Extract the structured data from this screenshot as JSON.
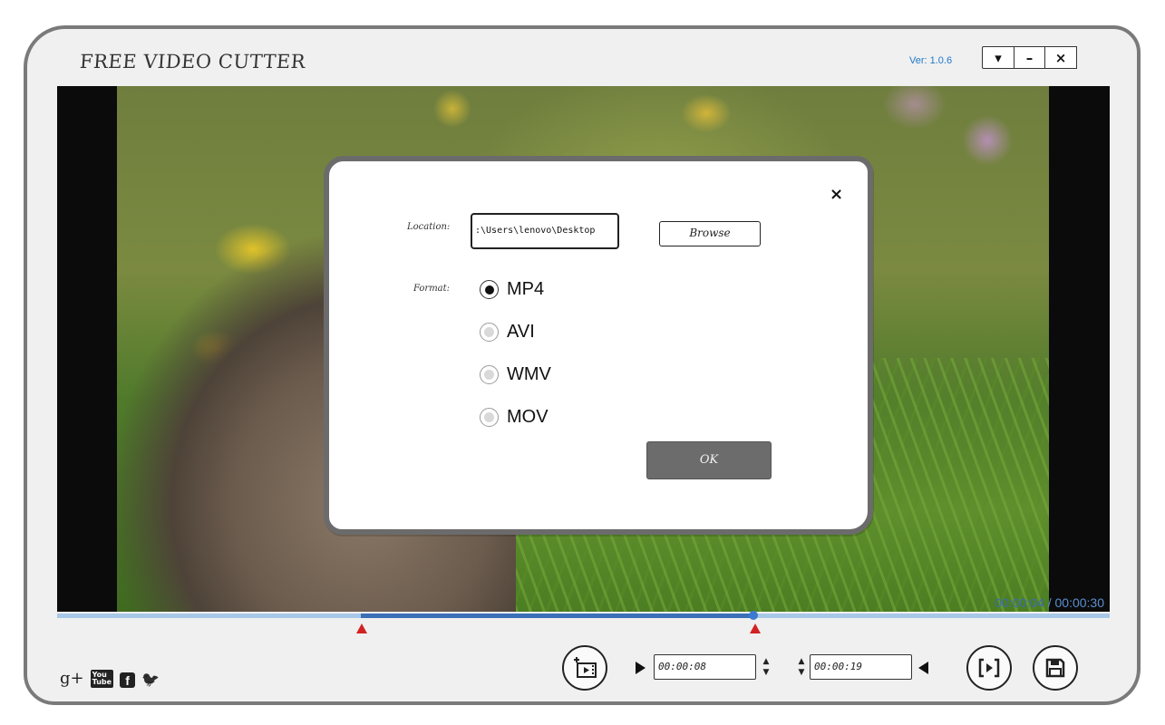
{
  "app": {
    "title": "FREE VIDEO CUTTER",
    "version": "Ver: 1.0.6",
    "window_buttons": {
      "dropdown": "▾",
      "minimize": "–",
      "close": "×"
    }
  },
  "video": {
    "current_time": "00:00:04",
    "separator": " / ",
    "total_time": "00:00:30"
  },
  "timeline": {
    "selection_start_fraction": 0.29,
    "selection_end_fraction": 0.66,
    "playhead_fraction": 0.66,
    "colors": {
      "track": "#a8c8e8",
      "selection": "#3b6fb8",
      "marker": "#d22222"
    }
  },
  "controls": {
    "start_time": "00:00:08",
    "end_time": "00:00:19",
    "spinner_up": "▲",
    "spinner_down": "▼",
    "icons": [
      "add-clip-icon",
      "play-start-icon",
      "play-end-icon",
      "preview-icon",
      "save-icon"
    ]
  },
  "social": {
    "google_plus": "g+",
    "youtube_top": "You",
    "youtube_bottom": "Tube",
    "facebook": "f",
    "twitter": "🐦"
  },
  "dialog": {
    "close": "×",
    "location_label": "Location:",
    "location_value": ":\\Users\\lenovo\\Desktop",
    "browse_label": "Browse",
    "format_label": "Format:",
    "formats": [
      {
        "label": "MP4",
        "selected": true
      },
      {
        "label": "AVI",
        "selected": false
      },
      {
        "label": "WMV",
        "selected": false
      },
      {
        "label": "MOV",
        "selected": false
      }
    ],
    "ok_label": "OK"
  }
}
